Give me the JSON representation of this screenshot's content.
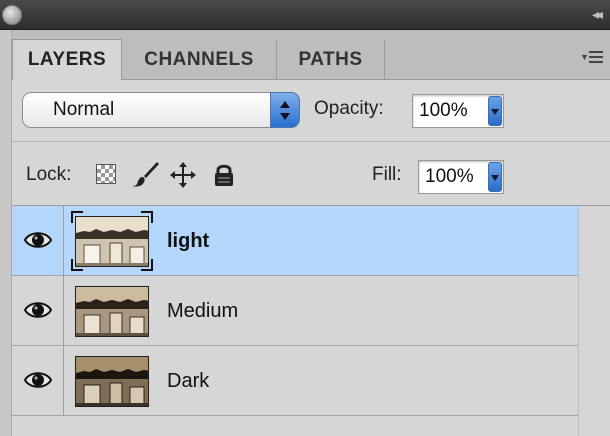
{
  "window": {
    "collapse_glyph": "◂◂"
  },
  "tabs": [
    {
      "label": "LAYERS",
      "active": true
    },
    {
      "label": "CHANNELS",
      "active": false
    },
    {
      "label": "PATHS",
      "active": false
    }
  ],
  "blend": {
    "mode": "Normal",
    "opacity_label": "Opacity:",
    "opacity": "100%"
  },
  "lock": {
    "label": "Lock:",
    "icons": [
      "lock-transparent-pixels-icon",
      "lock-image-pixels-icon",
      "lock-position-icon",
      "lock-all-icon"
    ]
  },
  "fill": {
    "label": "Fill:",
    "value": "100%"
  },
  "layers": [
    {
      "name": "light",
      "selected": true,
      "visible": true
    },
    {
      "name": "Medium",
      "selected": false,
      "visible": true
    },
    {
      "name": "Dark",
      "selected": false,
      "visible": true
    }
  ],
  "colors": {
    "selection": "#b4d6fb",
    "panel": "#d6d6d6",
    "accent_blue": "#2b6cc9"
  }
}
